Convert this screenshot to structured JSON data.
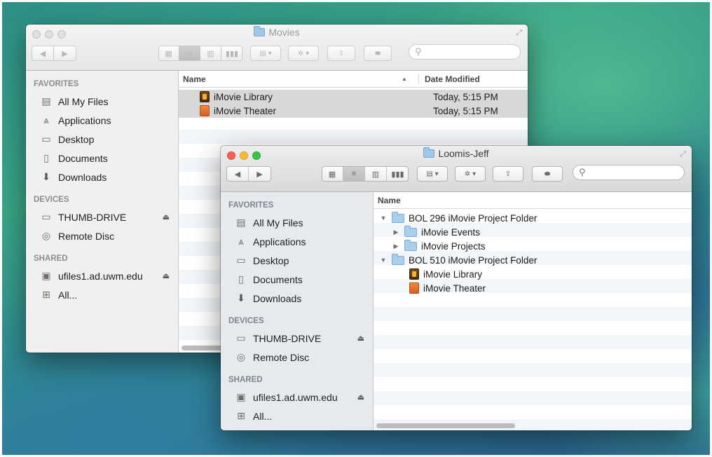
{
  "back_window": {
    "title": "Movies",
    "search_icon": "magnifier-icon",
    "sidebar": {
      "favorites_header": "FAVORITES",
      "favorites": [
        {
          "label": "All My Files",
          "icon": "all-files-icon"
        },
        {
          "label": "Applications",
          "icon": "applications-icon"
        },
        {
          "label": "Desktop",
          "icon": "desktop-icon"
        },
        {
          "label": "Documents",
          "icon": "documents-icon"
        },
        {
          "label": "Downloads",
          "icon": "downloads-icon"
        }
      ],
      "devices_header": "DEVICES",
      "devices": [
        {
          "label": "THUMB-DRIVE",
          "icon": "drive-icon",
          "eject": "⏏"
        },
        {
          "label": "Remote Disc",
          "icon": "disc-icon"
        }
      ],
      "shared_header": "SHARED",
      "shared": [
        {
          "label": "ufiles1.ad.uwm.edu",
          "icon": "server-icon",
          "eject": "⏏"
        },
        {
          "label": "All...",
          "icon": "network-icon"
        }
      ]
    },
    "columns": {
      "name": "Name",
      "sort_arrow": "▲",
      "date": "Date Modified"
    },
    "files": [
      {
        "name": "iMovie Library",
        "date": "Today, 5:15 PM",
        "icon": "imovie-library-icon"
      },
      {
        "name": "iMovie Theater",
        "date": "Today, 5:15 PM",
        "icon": "imovie-theater-icon"
      }
    ]
  },
  "front_window": {
    "title": "Loomis-Jeff",
    "sidebar": {
      "favorites_header": "FAVORITES",
      "favorites": [
        {
          "label": "All My Files",
          "icon": "all-files-icon"
        },
        {
          "label": "Applications",
          "icon": "applications-icon"
        },
        {
          "label": "Desktop",
          "icon": "desktop-icon"
        },
        {
          "label": "Documents",
          "icon": "documents-icon"
        },
        {
          "label": "Downloads",
          "icon": "downloads-icon"
        }
      ],
      "devices_header": "DEVICES",
      "devices": [
        {
          "label": "THUMB-DRIVE",
          "icon": "drive-icon",
          "eject": "⏏"
        },
        {
          "label": "Remote Disc",
          "icon": "disc-icon"
        }
      ],
      "shared_header": "SHARED",
      "shared": [
        {
          "label": "ufiles1.ad.uwm.edu",
          "icon": "server-icon",
          "eject": "⏏"
        },
        {
          "label": "All...",
          "icon": "network-icon"
        }
      ]
    },
    "columns": {
      "name": "Name"
    },
    "tree": [
      {
        "name": "BOL 296 iMovie Project Folder",
        "type": "folder",
        "expanded": true,
        "level": 0
      },
      {
        "name": "iMovie Events",
        "type": "folder",
        "expanded": false,
        "level": 1
      },
      {
        "name": "iMovie Projects",
        "type": "folder",
        "expanded": false,
        "level": 1
      },
      {
        "name": "BOL 510 iMovie Project Folder",
        "type": "folder",
        "expanded": true,
        "level": 0
      },
      {
        "name": "iMovie Library",
        "type": "library",
        "level": 1
      },
      {
        "name": "iMovie Theater",
        "type": "theater",
        "level": 1
      }
    ]
  },
  "glyphs": {
    "back": "◀",
    "forward": "▶",
    "view_icon": "▦",
    "view_list": "≡",
    "view_column": "▥",
    "view_coverflow": "▮▮▮",
    "arrange": "▤ ▾",
    "action": "✲ ▾",
    "share": "⇪",
    "tag": "⬬",
    "search": "⚲",
    "fullscreen": "⤢",
    "disclosure_open": "▼",
    "disclosure_closed": "▶"
  },
  "colors": {
    "selection": "#d8d8d8",
    "sidebar_bg": "#e6e9ee",
    "close": "#fc5f57",
    "minimize": "#fdbc2e",
    "zoom": "#33c748"
  }
}
